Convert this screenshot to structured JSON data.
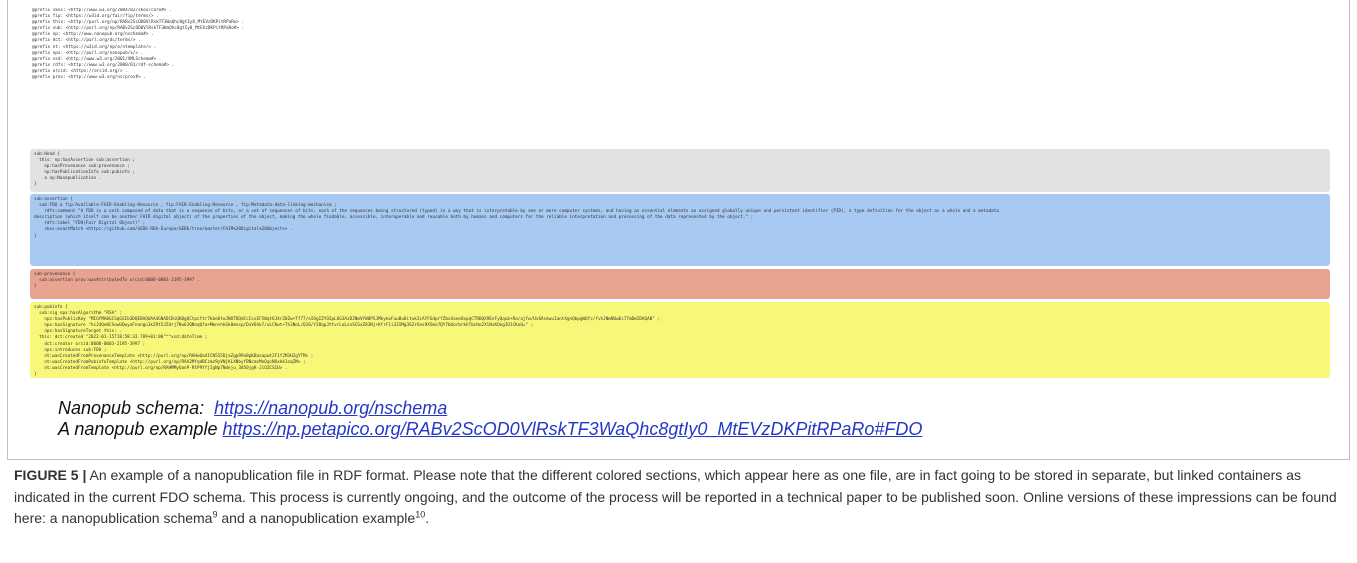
{
  "code": {
    "prefixes": [
      "@prefix skos: <http://www.w3.org/2004/02/skos/core#> .",
      "@prefix fip: <https://w3id.org/fair/fip/terms/> .",
      "@prefix this: <http://purl.org/np/RABv2ScOD0VlRskTF3WaQhc8gtIy0_MtEVzDKPitRPaRo> .",
      "@prefix sub: <http://purl.org/np/RABv2ScOD0VlRskTF3WaQhc8gtIy0_MtEVzDKPitRPaRo#> .",
      "@prefix np: <http://www.nanopub.org/nschema#> .",
      "@prefix dct: <http://purl.org/dc/terms/> .",
      "@prefix nt: <https://w3id.org/np/o/ntemplate/> .",
      "@prefix npx: <http://purl.org/nanopub/x/> .",
      "@prefix xsd: <http://www.w3.org/2001/XMLSchema#> .",
      "@prefix rdfs: <http://www.w3.org/2000/01/rdf-schema#> .",
      "@prefix orcid: <https://orcid.org/> .",
      "@prefix prov: <http://www.w3.org/ns/prov#> ."
    ],
    "head": [
      "sub:Head {",
      "  this: np:hasAssertion sub:assertion ;",
      "    np:hasProvenance sub:provenance ;",
      "    np:hasPublicationInfo sub:pubinfo ;",
      "    a np:Nanopublication .",
      "}"
    ],
    "assertion": [
      "sub:assertion {",
      "  sub:FDO a fip:Available-FAIR-Enabling-Resource , fip:FAIR-Enabling-Resource , fip:Metadata-data-linking-mechanism ;",
      "    rdfs:comment \"A FDO is a unit composed of data that is a sequence of bits, or a set of sequences of bits, each of the sequences being structured (typed) in a way that is interpretable by one or more computer systems, and having as essential elements an assigned globally unique and persistent identifier (PID), a type definition for the object as a whole and a metadata",
      "description (which itself can be another FAIR digital object) of the properties of the object, making the whole findable, accessible, interoperable and reusable both by humans and computers for the reliable interpretation and processing of the data represented by the object.\" ;",
      "    rdfs:label \"FDO(Fair Digital Object)\" ;",
      "    skos:exactMatch <https://github.com/GEDE-RDA-Europe/GEDE/tree/master/FAIR%20Digital%20Objects> .",
      "}"
    ],
    "provenance": [
      "sub:provenance {",
      "  sub:assertion prov:wasAttributedTo orcid:0000-0003-2195-3997 .",
      "}"
    ],
    "pubinfo": [
      "sub:pubinfo {",
      "  sub:sig npx:hasAlgorithm \"RSA\" ;",
      "    npx:hasPublicKey \"MIGfMA0GCSqGSIb3DQEBAQUAA4GNADCBiQKBgQCtpcftr7kbe6toJNOTDQdCcCssEF5Wqt6J4rZ0Zw+Tf77/eIOgIZYOIpL6G3AzDZNmVYW0PSJMkykoFuuBu8ituk3iAYFGdprfZbvXaneOxpqCTRBQX9EnFyQqub+Ra/ajfw/Us6AskwuIantXgnQbpgWQfc/fvhJNmNUwEc77mDmIDAQAB\" ;",
      "    npx:hasSignature \"hcJ4Qe0CSowUQwyaFnongu1kZ9t5JZdrj7Nu6JQNnqQfa+Mmn+hkSk0mnxp/DuV6hk7/uLCKwt+Th3NoL/Q16/Y20qpJttvrLoLzxSCGxZ83Nj+KfrF1i33IMg36ZrGns9X5mo7QY7bUorbrkhTbcHo2XlNsKOngIO1CKoQ=\" ;",
      "    npx:hasSignatureTarget this: .",
      "  this: dct:created \"2022-01-15T18:58:33.789+01:00\"^^xsd:dateTime ;",
      "    dct:creator orcid:0000-0003-2195-3997 ;",
      "    npx:introduces sub:FDO ;",
      "    nt:wasCreatedFromProvenanceTemplate <http://purl.org/np/RAHwQa4ICN5S5DjaZgp99nBpKBasapwt2F1f2M3H2gYTM> ;",
      "    nt:wasCreatedFromPubinfoTemplate <http://purl.org/np/RAA2MfqdBCzmz9yVNjKLXNbyfBNcmsMnQqcNUxkk1nqIM> ;",
      "    nt:wasCreatedFromTemplate <http://purl.org/np/RAHMMyUanP-RtP9YfjIgNp7Ndeju_3850jgK-JiOZCSIU> .",
      "}"
    ]
  },
  "links": {
    "schema_label": "Nanopub schema:",
    "schema_url": "https://nanopub.org/nschema",
    "example_label": "A nanopub example",
    "example_url": "https://np.petapico.org/RABv2ScOD0VlRskTF3WaQhc8gtIy0_MtEVzDKPitRPaRo#FDO"
  },
  "caption": {
    "label": "FIGURE 5 |",
    "text_before_sup9": " An example of a nanopublication file in RDF format. Please note that the different colored sections, which appear here as one file, are in fact going to be stored in separate, but linked containers as indicated in the current FDO schema. This process is currently ongoing, and the outcome of the process will be reported in a technical paper to be published soon. Online versions of these impressions can be found here: a nanopublication schema",
    "sup9": "9",
    "text_between": " and a nanopublication example",
    "sup10": "10",
    "text_end": "."
  }
}
